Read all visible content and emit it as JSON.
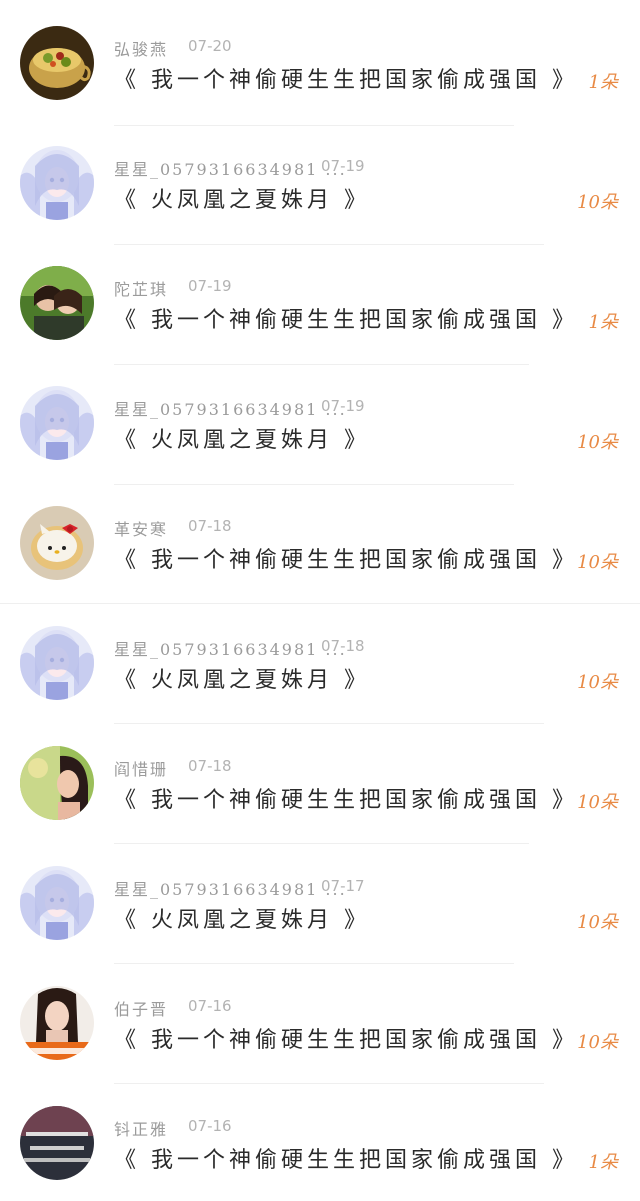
{
  "items": [
    {
      "user": "弘骏燕",
      "date": "07-20",
      "title": "《 我一个神偷硬生生把国家偷成强国 》",
      "count": "1朵",
      "avatar": "teacup-avatar"
    },
    {
      "user": "星星_0579316634981 ...",
      "date": "07-19",
      "title": "《 火凤凰之夏姝月 》",
      "count": "10朵",
      "avatar": "anime-girl-avatar"
    },
    {
      "user": "陀芷琪",
      "date": "07-19",
      "title": "《 我一个神偷硬生生把国家偷成强国 》",
      "count": "1朵",
      "avatar": "couple-avatar"
    },
    {
      "user": "星星_0579316634981 ...",
      "date": "07-19",
      "title": "《 火凤凰之夏姝月 》",
      "count": "10朵",
      "avatar": "anime-girl-avatar"
    },
    {
      "user": "革安寒",
      "date": "07-18",
      "title": "《 我一个神偷硬生生把国家偷成强国 》",
      "count": "10朵",
      "avatar": "hello-kitty-avatar"
    },
    {
      "user": "星星_0579316634981 ...",
      "date": "07-18",
      "title": "《 火凤凰之夏姝月 》",
      "count": "10朵",
      "avatar": "anime-girl-avatar"
    },
    {
      "user": "阎惜珊",
      "date": "07-18",
      "title": "《 我一个神偷硬生生把国家偷成强国 》",
      "count": "10朵",
      "avatar": "woman-portrait-avatar"
    },
    {
      "user": "星星_0579316634981 ...",
      "date": "07-17",
      "title": "《 火凤凰之夏姝月 》",
      "count": "10朵",
      "avatar": "anime-girl-avatar"
    },
    {
      "user": "伯子晋",
      "date": "07-16",
      "title": "《 我一个神偷硬生生把国家偷成强国 》",
      "count": "10朵",
      "avatar": "girl-photo-avatar"
    },
    {
      "user": "钭正雅",
      "date": "07-16",
      "title": "《 我一个神偷硬生生把国家偷成强国 》",
      "count": "1朵",
      "avatar": "quote-text-avatar"
    }
  ],
  "colors": {
    "count": "#e88a45",
    "title": "#2b2b2b",
    "meta": "#9b9b9b",
    "divider": "#efefef"
  }
}
